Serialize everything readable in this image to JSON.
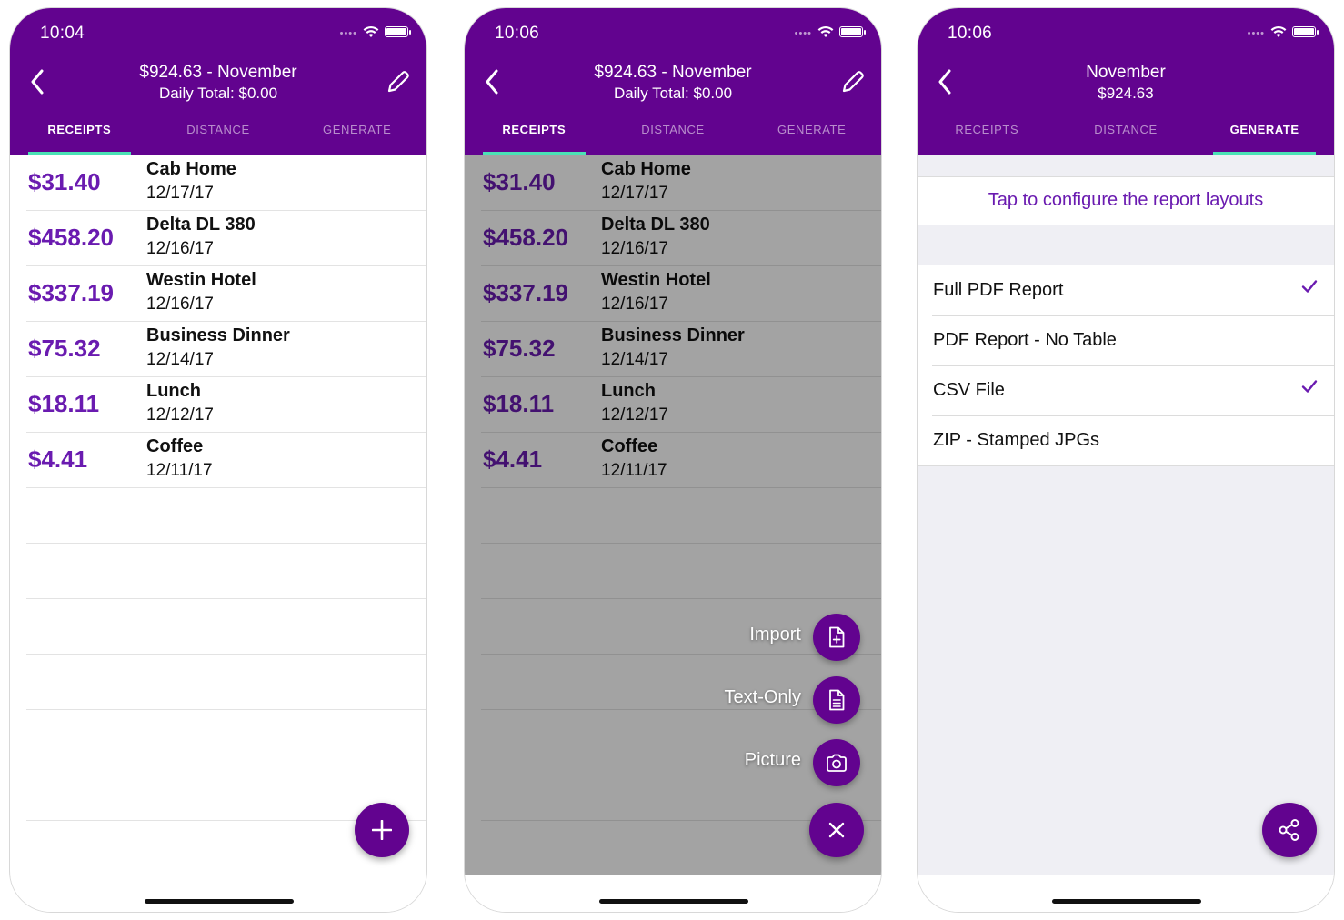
{
  "colors": {
    "brand": "#62038f",
    "accent": "#4be2b5",
    "price": "#6a1bb0"
  },
  "screens": [
    {
      "status_time": "10:04",
      "title": "$924.63 - November",
      "subtitle": "Daily Total: $0.00",
      "tabs": [
        {
          "label": "RECEIPTS",
          "active": true
        },
        {
          "label": "DISTANCE",
          "active": false
        },
        {
          "label": "GENERATE",
          "active": false
        }
      ]
    },
    {
      "status_time": "10:06",
      "title": "$924.63 - November",
      "subtitle": "Daily Total: $0.00",
      "tabs": [
        {
          "label": "RECEIPTS",
          "active": true
        },
        {
          "label": "DISTANCE",
          "active": false
        },
        {
          "label": "GENERATE",
          "active": false
        }
      ],
      "fab_menu": [
        {
          "label": "Import",
          "icon": "file-plus-icon"
        },
        {
          "label": "Text-Only",
          "icon": "file-text-icon"
        },
        {
          "label": "Picture",
          "icon": "camera-icon"
        }
      ]
    },
    {
      "status_time": "10:06",
      "title": "November",
      "subtitle": "$924.63",
      "tabs": [
        {
          "label": "RECEIPTS",
          "active": false
        },
        {
          "label": "DISTANCE",
          "active": false
        },
        {
          "label": "GENERATE",
          "active": true
        }
      ],
      "configure_label": "Tap to configure the report layouts",
      "report_options": [
        {
          "label": "Full PDF Report",
          "checked": true
        },
        {
          "label": "PDF Report - No Table",
          "checked": false
        },
        {
          "label": "CSV File",
          "checked": true
        },
        {
          "label": "ZIP - Stamped JPGs",
          "checked": false
        }
      ]
    }
  ],
  "receipts": [
    {
      "price": "$31.40",
      "name": "Cab Home",
      "date": "12/17/17"
    },
    {
      "price": "$458.20",
      "name": "Delta DL 380",
      "date": "12/16/17"
    },
    {
      "price": "$337.19",
      "name": "Westin Hotel",
      "date": "12/16/17"
    },
    {
      "price": "$75.32",
      "name": "Business Dinner",
      "date": "12/14/17"
    },
    {
      "price": "$18.11",
      "name": "Lunch",
      "date": "12/12/17"
    },
    {
      "price": "$4.41",
      "name": "Coffee",
      "date": "12/11/17"
    }
  ]
}
